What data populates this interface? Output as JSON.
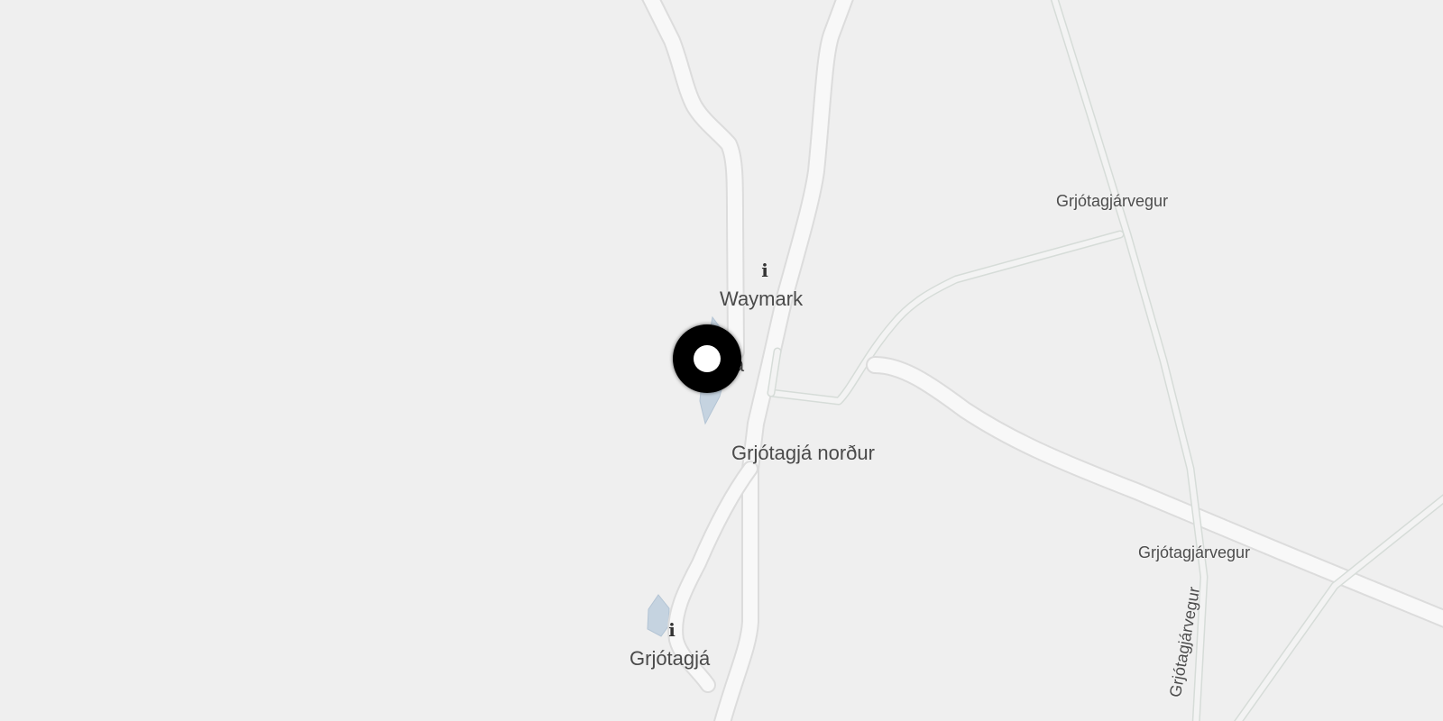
{
  "map": {
    "colors": {
      "land": "#efefef",
      "road": "#f8f8f8",
      "road_casing": "#dcdcdc",
      "water": "#c5d3e0",
      "marker": "#000000",
      "marker_center": "#ffffff"
    },
    "pois": [
      {
        "icon": "info-icon",
        "label": "Waymark"
      },
      {
        "icon": "info-icon",
        "label": "Grjótagjá"
      }
    ],
    "place_labels": {
      "partial_hidden": "já",
      "north": "Grjótagjá norður"
    },
    "road_labels": [
      "Grjótagjárvegur",
      "Grjótagjárvegur",
      "Grjótagjárvegur"
    ],
    "marker": {
      "type": "current-location"
    }
  }
}
